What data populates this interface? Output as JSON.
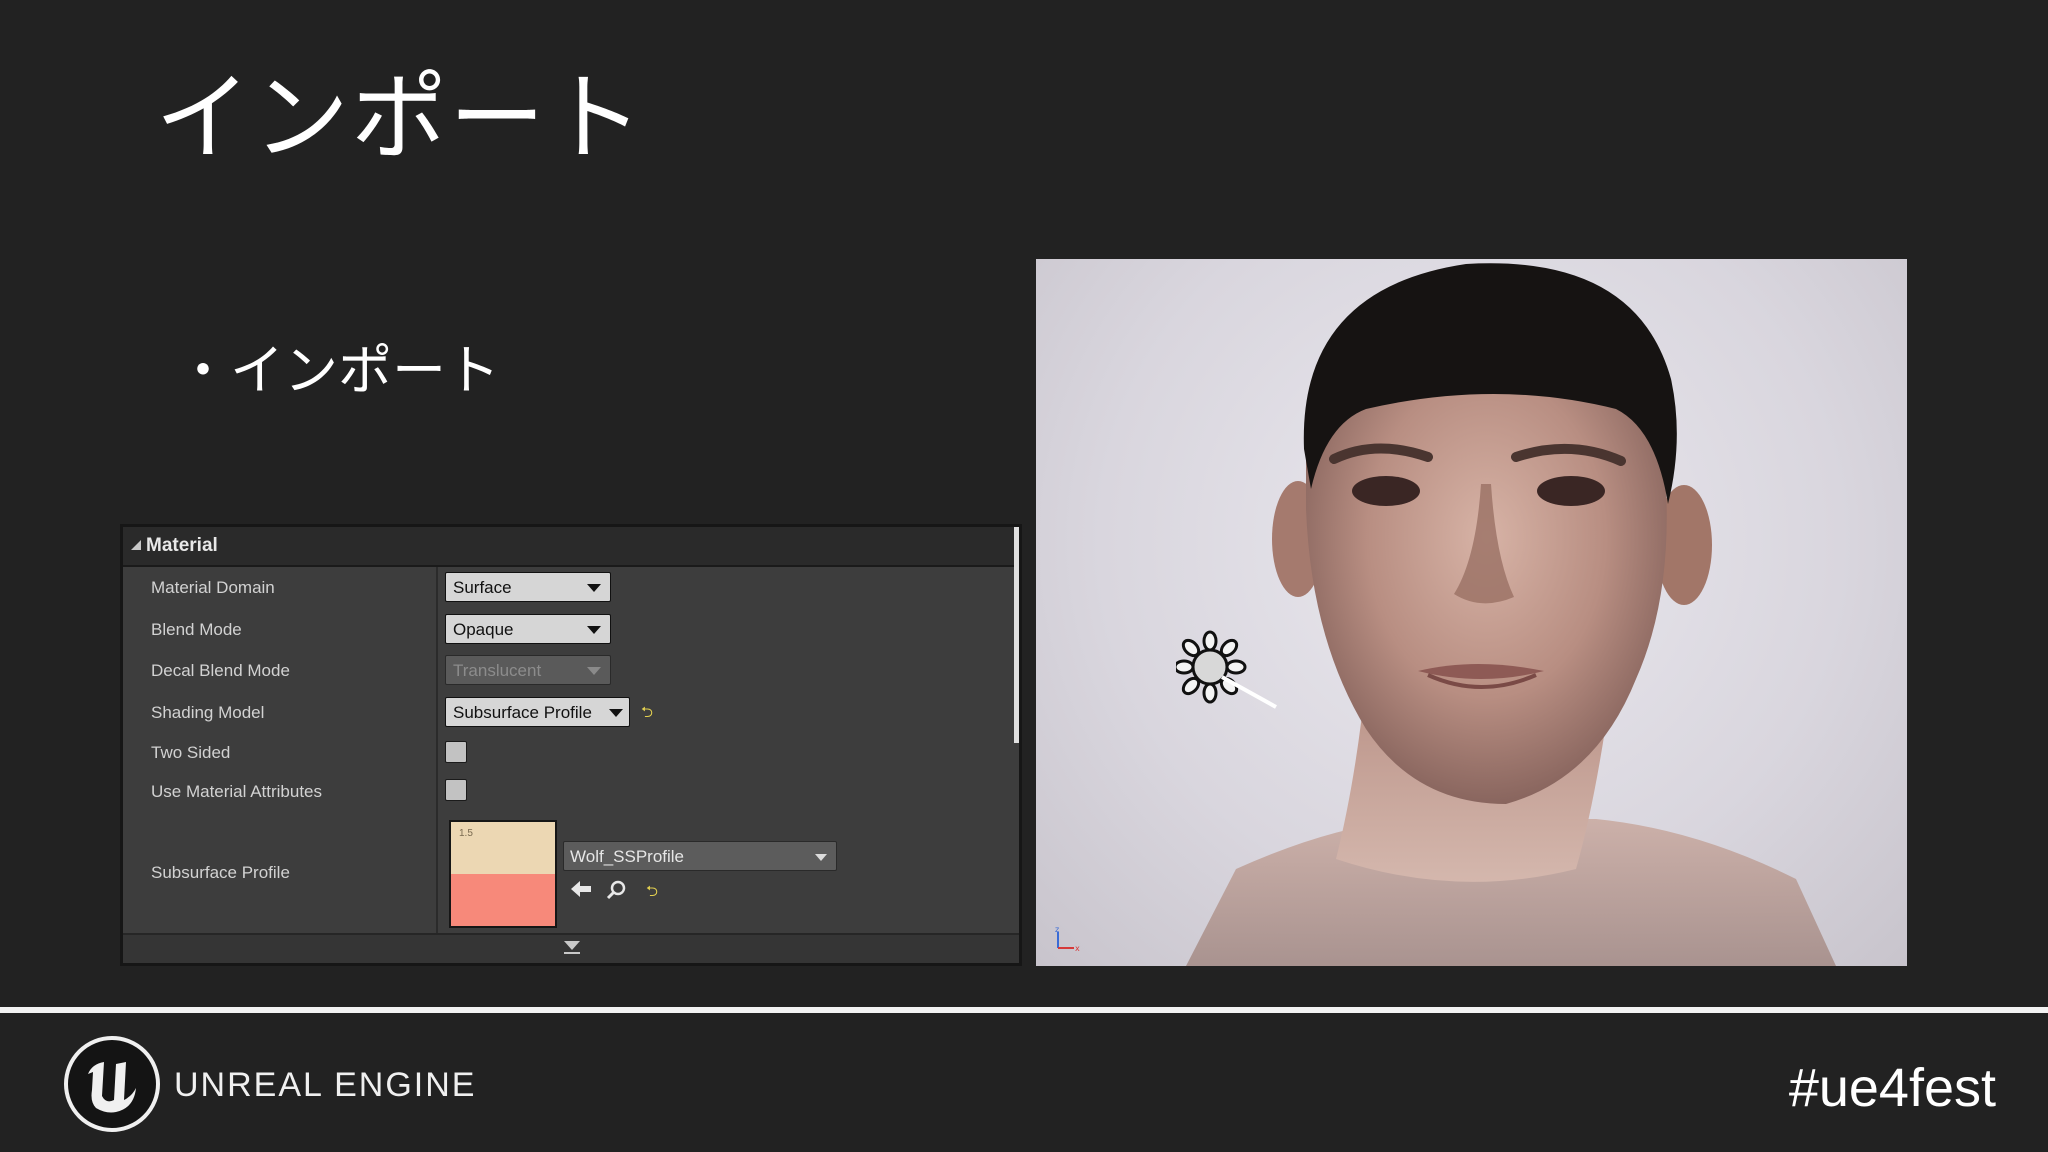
{
  "slide": {
    "title": "インポート",
    "bullet": "・インポート",
    "hashtag": "#ue4fest",
    "brand": "UNREAL ENGINE"
  },
  "details_panel": {
    "header": "Material",
    "rows": [
      {
        "label": "Material Domain",
        "value": "Surface"
      },
      {
        "label": "Blend Mode",
        "value": "Opaque"
      },
      {
        "label": "Decal Blend Mode",
        "value": "Translucent"
      },
      {
        "label": "Shading Model",
        "value": "Subsurface Profile"
      },
      {
        "label": "Two Sided",
        "checked": false
      },
      {
        "label": "Use Material Attributes",
        "checked": false
      },
      {
        "label": "Subsurface Profile",
        "asset": "Wolf_SSProfile",
        "thumb_text": "1.5"
      }
    ],
    "colors": {
      "thumb_top": "#ecd7b3",
      "thumb_bottom": "#f7897a",
      "reset_icon": "#e2d050"
    },
    "icons": [
      "reset-arrow-icon",
      "back-arrow-icon",
      "search-icon",
      "expand-arrow-icon"
    ]
  },
  "viewport": {
    "subject": "head render",
    "icons": [
      "light-source-icon",
      "axis-gizmo-icon"
    ]
  }
}
